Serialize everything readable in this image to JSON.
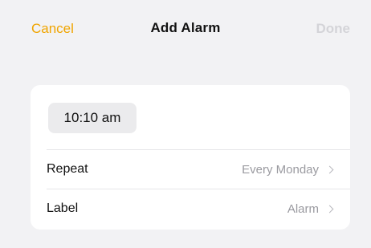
{
  "nav": {
    "cancel_label": "Cancel",
    "title": "Add Alarm",
    "done_label": "Done"
  },
  "alarm": {
    "time": "10:10 am",
    "rows": [
      {
        "label": "Repeat",
        "value": "Every Monday"
      },
      {
        "label": "Label",
        "value": "Alarm"
      }
    ]
  },
  "colors": {
    "accent": "#f0a500",
    "background": "#f2f2f4",
    "card": "#ffffff",
    "disabled_text": "#d4d4d8",
    "secondary_text": "#9a9aa0"
  },
  "icons": {
    "row_disclosure": "chevron-right-icon"
  }
}
